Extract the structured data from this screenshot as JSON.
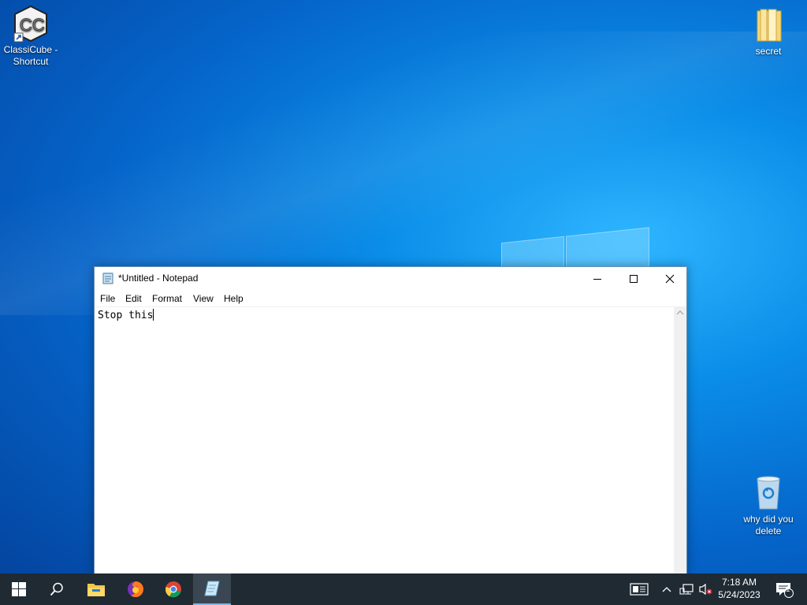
{
  "desktop": {
    "icons": [
      {
        "label": "ClassiCube - Shortcut",
        "icon": "classicube-shortcut-icon"
      },
      {
        "label": "secret",
        "icon": "folder-icon"
      },
      {
        "label": "why did you delete",
        "icon": "recycle-bin-icon"
      }
    ]
  },
  "notepad": {
    "title": "*Untitled - Notepad",
    "menu": [
      "File",
      "Edit",
      "Format",
      "View",
      "Help"
    ],
    "content": "Stop this"
  },
  "taskbar": {
    "apps": [
      "start-icon",
      "search-icon",
      "file-explorer-icon",
      "firefox-icon",
      "chrome-icon",
      "notepad-icon"
    ],
    "active_app": "notepad-icon",
    "clock": {
      "time": "7:18 AM",
      "date": "5/24/2023"
    },
    "notification_count": "1"
  },
  "colors": {
    "accent": "#76b9ed",
    "taskbar": "#1f2a33",
    "desktop": "#0a8de8"
  }
}
